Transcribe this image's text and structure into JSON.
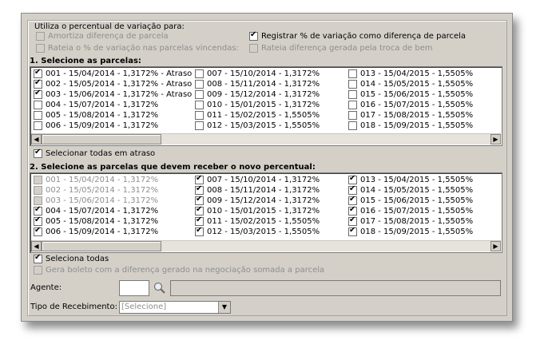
{
  "group_title": "Utiliza o percentual de variação para:",
  "options": {
    "amortiza": {
      "label": "Amortiza diferença de parcela",
      "checked": false,
      "enabled": false
    },
    "rateia_vincendas": {
      "label": "Rateia o % de variação nas parcelas vincendas:",
      "checked": false,
      "enabled": false
    },
    "registrar": {
      "label": "Registrar % de variação como diferença de parcela",
      "checked": true,
      "enabled": true
    },
    "rateia_troca": {
      "label": "Rateia diferença gerada pela troca de bem",
      "checked": false,
      "enabled": false
    }
  },
  "section1": {
    "title": "1. Selecione as parcelas:",
    "items": [
      {
        "label": "001 - 15/04/2014 - 1,3172% - Atraso",
        "checked": true
      },
      {
        "label": "002 - 15/05/2014 - 1,3172% - Atraso",
        "checked": true
      },
      {
        "label": "003 - 15/06/2014 - 1,3172% - Atraso",
        "checked": true
      },
      {
        "label": "004 - 15/07/2014 - 1,3172%",
        "checked": false
      },
      {
        "label": "005 - 15/08/2014 - 1,3172%",
        "checked": false
      },
      {
        "label": "006 - 15/09/2014 - 1,3172%",
        "checked": false
      },
      {
        "label": "007 - 15/10/2014 - 1,3172%",
        "checked": false
      },
      {
        "label": "008 - 15/11/2014 - 1,3172%",
        "checked": false
      },
      {
        "label": "009 - 15/12/2014 - 1,3172%",
        "checked": false
      },
      {
        "label": "010 - 15/01/2015 - 1,3172%",
        "checked": false
      },
      {
        "label": "011 - 15/02/2015 - 1,5505%",
        "checked": false
      },
      {
        "label": "012 - 15/03/2015 - 1,5505%",
        "checked": false
      },
      {
        "label": "013 - 15/04/2015 - 1,5505%",
        "checked": false
      },
      {
        "label": "014 - 15/05/2015 - 1,5505%",
        "checked": false
      },
      {
        "label": "015 - 15/06/2015 - 1,5505%",
        "checked": false
      },
      {
        "label": "016 - 15/07/2015 - 1,5505%",
        "checked": false
      },
      {
        "label": "017 - 15/08/2015 - 1,5505%",
        "checked": false
      },
      {
        "label": "018 - 15/09/2015 - 1,5505%",
        "checked": false
      }
    ],
    "select_all_late": {
      "label": "Selecionar todas em atraso",
      "checked": true
    }
  },
  "section2": {
    "title": "2. Selecione as parcelas que devem receber o novo percentual:",
    "items": [
      {
        "label": "001 - 15/04/2014 - 1,3172%",
        "checked": false,
        "enabled": false
      },
      {
        "label": "002 - 15/05/2014 - 1,3172%",
        "checked": false,
        "enabled": false
      },
      {
        "label": "003 - 15/06/2014 - 1,3172%",
        "checked": false,
        "enabled": false
      },
      {
        "label": "004 - 15/07/2014 - 1,3172%",
        "checked": true,
        "enabled": true
      },
      {
        "label": "005 - 15/08/2014 - 1,3172%",
        "checked": true,
        "enabled": true
      },
      {
        "label": "006 - 15/09/2014 - 1,3172%",
        "checked": true,
        "enabled": true
      },
      {
        "label": "007 - 15/10/2014 - 1,3172%",
        "checked": true,
        "enabled": true
      },
      {
        "label": "008 - 15/11/2014 - 1,3172%",
        "checked": true,
        "enabled": true
      },
      {
        "label": "009 - 15/12/2014 - 1,3172%",
        "checked": true,
        "enabled": true
      },
      {
        "label": "010 - 15/01/2015 - 1,3172%",
        "checked": true,
        "enabled": true
      },
      {
        "label": "011 - 15/02/2015 - 1,5505%",
        "checked": true,
        "enabled": true
      },
      {
        "label": "012 - 15/03/2015 - 1,5505%",
        "checked": true,
        "enabled": true
      },
      {
        "label": "013 - 15/04/2015 - 1,5505%",
        "checked": true,
        "enabled": true
      },
      {
        "label": "014 - 15/05/2015 - 1,5505%",
        "checked": true,
        "enabled": true
      },
      {
        "label": "015 - 15/06/2015 - 1,5505%",
        "checked": true,
        "enabled": true
      },
      {
        "label": "016 - 15/07/2015 - 1,5505%",
        "checked": true,
        "enabled": true
      },
      {
        "label": "017 - 15/08/2015 - 1,5505%",
        "checked": true,
        "enabled": true
      },
      {
        "label": "018 - 15/09/2015 - 1,5505%",
        "checked": true,
        "enabled": true
      }
    ],
    "select_all": {
      "label": "Seleciona todas",
      "checked": true
    },
    "gera_boleto": {
      "label": "Gera boleto com a diferença gerado na negociação somada a parcela",
      "checked": false,
      "enabled": false
    }
  },
  "agente": {
    "label": "Agente:",
    "code": "",
    "description": "",
    "search_icon": "magnifier-icon"
  },
  "recebimento": {
    "label": "Tipo de Recebimento:",
    "value": "[Selecione]"
  }
}
